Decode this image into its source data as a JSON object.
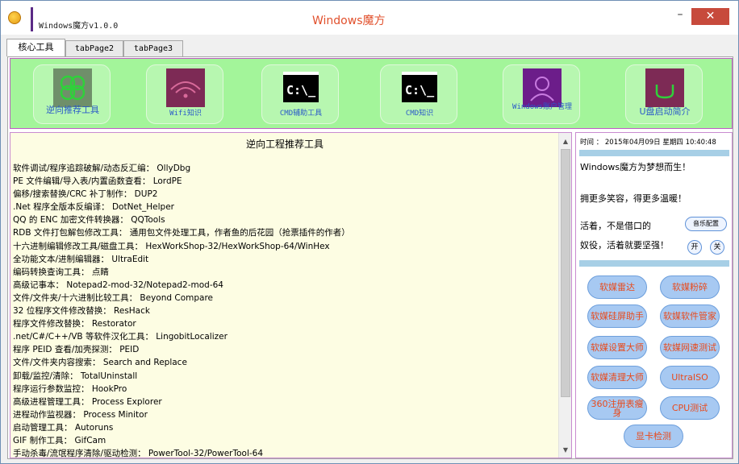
{
  "window": {
    "title": "Windows魔方v1.0.0",
    "center_title": "Windows魔方",
    "minimize": "–",
    "close": "✕"
  },
  "tabs": [
    {
      "label": "核心工具"
    },
    {
      "label": "tabPage2"
    },
    {
      "label": "tabPage3"
    }
  ],
  "toolbar": [
    {
      "label": "逆向推荐工具",
      "icon": "clover-icon",
      "color": "#6f8f6a"
    },
    {
      "label": "Wifi知识",
      "icon": "wifi-icon",
      "color": "#7d2a55"
    },
    {
      "label": "CMD辅助工具",
      "icon": "cmd-icon",
      "color": "#000000"
    },
    {
      "label": "CMD知识",
      "icon": "cmd-icon",
      "color": "#000000"
    },
    {
      "label": "Windows账户管理",
      "icon": "user-icon",
      "color": "#6c1d8a"
    },
    {
      "label": "U盘启动简介",
      "icon": "usb-icon",
      "color": "#7d2a55"
    }
  ],
  "content": {
    "title": "逆向工程推荐工具",
    "lines": [
      "软件调试/程序追踪破解/动态反汇编： OllyDbg",
      "PE 文件编辑/导入表/内置函数查看： LordPE",
      "偏移/搜索替换/CRC 补丁制作： DUP2",
      ".Net 程序全版本反编译： DotNet_Helper",
      "QQ 的 ENC 加密文件转换器： QQTools",
      "RDB 文件打包解包修改工具： 通用包文件处理工具，作者鱼的后花园（抢票插件的作者）",
      "十六进制编辑修改工具/磁盘工具： HexWorkShop-32/HexWorkShop-64/WinHex",
      "全功能文本/进制编辑器： UltraEdit",
      "编码转换查询工具： 点睛",
      "高级记事本： Notepad2-mod-32/Notepad2-mod-64",
      "文件/文件夹/十六进制比较工具： Beyond Compare",
      "32 位程序文件修改替换： ResHack",
      "程序文件修改替换： Restorator",
      ".net/C#/C++/VB 等软件汉化工具： LingobitLocalizer",
      "程序 PEID 查看/加壳探测： PEID",
      "文件/文件夹内容搜索： Search and Replace",
      "卸载/监控/清除： TotalUninstall",
      "程序运行参数监控： HookPro",
      "高级进程管理工具： Process Explorer",
      "进程动作监视器： Process Minitor",
      "启动管理工具： Autoruns",
      "GIF 制作工具： GifCam",
      "手动杀毒/流氓程序清除/驱动检测： PowerTool-32/PowerTool-64"
    ]
  },
  "side": {
    "time": "时间 ： 2015年04月09日 星期四 10:40:48",
    "motto1": "Windows魔方为梦想而生！",
    "motto2": "拥更多笑容，得更多温暖！",
    "motto3": "活着，不是借口的",
    "motto4": "奴役，活着就要坚强！",
    "music": "音乐配置",
    "on": "开",
    "off": "关",
    "buttons": [
      "软媒雷达",
      "软媒粉碎",
      "软媒硅屏助手",
      "软媒软件管家",
      "软媒设置大师",
      "软媒网速测试",
      "软媒清理大师",
      "UltraISO",
      "360注册表瘦身",
      "CPU测试",
      "显卡检测"
    ]
  },
  "colors": {
    "toolbar_bg": "#a3f59a",
    "content_bg": "#fdfde3",
    "accent_title": "#e1502c",
    "pill_bg": "#a7c9f2",
    "pill_text": "#e84a1c",
    "close_bg": "#c74a3c"
  }
}
